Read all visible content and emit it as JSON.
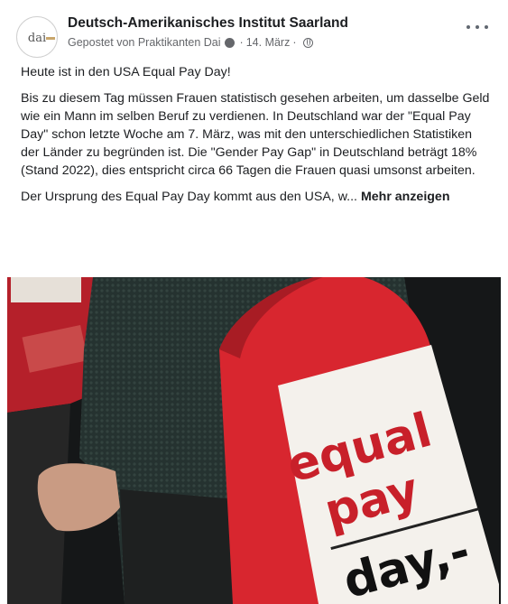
{
  "post": {
    "page_name": "Deutsch-Amerikanisches Institut Saarland",
    "avatar_text": "dai",
    "posted_by": "Gepostet von Praktikanten Dai",
    "date": "14. März",
    "separator": "·",
    "paragraphs": [
      "Heute ist in den USA Equal Pay Day!",
      "Bis zu diesem Tag müssen Frauen statistisch gesehen arbeiten, um dasselbe Geld wie ein Mann im selben Beruf zu verdienen. In Deutschland war der \"Equal Pay Day\" schon letzte Woche am 7. März, was mit den unterschiedlichen Statistiken der Länder zu begründen ist. Die \"Gender Pay Gap\" in Deutschland beträgt 18% (Stand 2022), dies entspricht circa 66 Tagen die Frauen quasi umsonst arbeiten."
    ],
    "teaser": "Der Ursprung des Equal Pay Day kommt aus den USA, w...",
    "see_more": "Mehr anzeigen"
  },
  "photo": {
    "bag_lines": [
      "equal",
      "pay",
      "day,-"
    ]
  },
  "icons": {
    "more": "more-options-icon",
    "privacy": "globe-icon",
    "author": "profile-dot-icon"
  },
  "colors": {
    "bag_red": "#d8262f",
    "text": "#1c1e21",
    "meta": "#65676b"
  }
}
